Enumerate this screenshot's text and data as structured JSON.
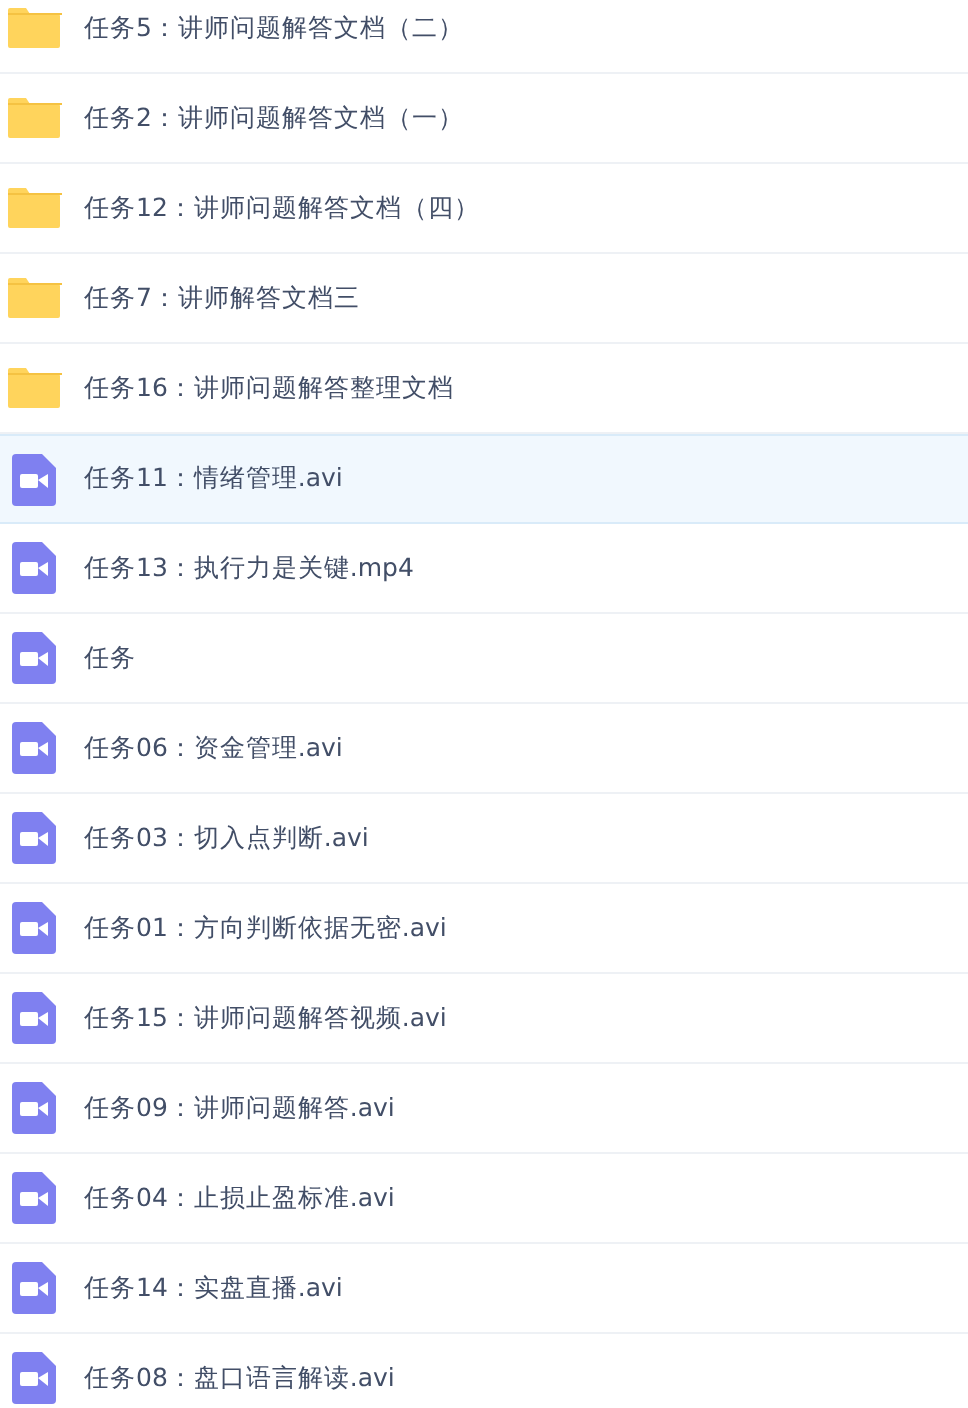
{
  "files": [
    {
      "kind": "folder",
      "name": "任务5：讲师问题解答文档（二）",
      "selected": false
    },
    {
      "kind": "folder",
      "name": "任务2：讲师问题解答文档（一）",
      "selected": false
    },
    {
      "kind": "folder",
      "name": "任务12：讲师问题解答文档（四）",
      "selected": false
    },
    {
      "kind": "folder",
      "name": "任务7：讲师解答文档三",
      "selected": false
    },
    {
      "kind": "folder",
      "name": "任务16：讲师问题解答整理文档",
      "selected": false
    },
    {
      "kind": "video",
      "name": "任务11：情绪管理.avi",
      "selected": true
    },
    {
      "kind": "video",
      "name": "任务13：执行力是关键.mp4",
      "selected": false
    },
    {
      "kind": "video",
      "name": "任务",
      "selected": false
    },
    {
      "kind": "video",
      "name": "任务06：资金管理.avi",
      "selected": false
    },
    {
      "kind": "video",
      "name": "任务03：切入点判断.avi",
      "selected": false
    },
    {
      "kind": "video",
      "name": "任务01：方向判断依据无密.avi",
      "selected": false
    },
    {
      "kind": "video",
      "name": "任务15：讲师问题解答视频.avi",
      "selected": false
    },
    {
      "kind": "video",
      "name": "任务09：讲师问题解答.avi",
      "selected": false
    },
    {
      "kind": "video",
      "name": "任务04：止损止盈标准.avi",
      "selected": false
    },
    {
      "kind": "video",
      "name": "任务14：实盘直播.avi",
      "selected": false
    },
    {
      "kind": "video",
      "name": "任务08：盘口语言解读.avi",
      "selected": false
    }
  ]
}
